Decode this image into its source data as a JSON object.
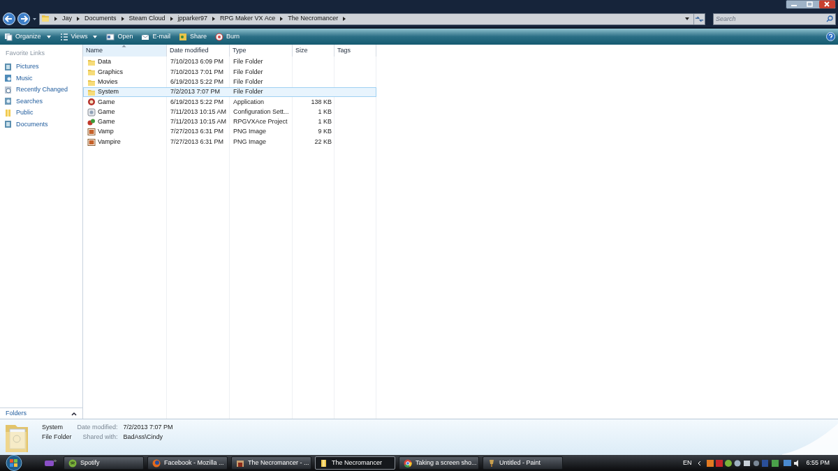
{
  "address_bar": {
    "crumbs": [
      "Jay",
      "Documents",
      "Steam Cloud",
      "jpparker97",
      "RPG Maker VX Ace",
      "The Necromancer"
    ]
  },
  "search": {
    "placeholder": "Search"
  },
  "toolbar": [
    {
      "label": "Organize",
      "kind": "organize",
      "dropdown": true
    },
    {
      "label": "Views",
      "kind": "views",
      "dropdown": true
    },
    {
      "label": "Open",
      "kind": "open",
      "dropdown": false
    },
    {
      "label": "E-mail",
      "kind": "email",
      "dropdown": false
    },
    {
      "label": "Share",
      "kind": "share",
      "dropdown": false
    },
    {
      "label": "Burn",
      "kind": "burn",
      "dropdown": false
    }
  ],
  "sidebar": {
    "heading": "Favorite Links",
    "items": [
      {
        "label": "Pictures",
        "kind": "library"
      },
      {
        "label": "Music",
        "kind": "music"
      },
      {
        "label": "Recently Changed",
        "kind": "recent"
      },
      {
        "label": "Searches",
        "kind": "searches"
      },
      {
        "label": "Public",
        "kind": "folder"
      },
      {
        "label": "Documents",
        "kind": "library"
      }
    ],
    "folders_label": "Folders"
  },
  "table": {
    "columns": [
      {
        "label": "Name",
        "sorted": true
      },
      {
        "label": "Date modified",
        "sorted": false
      },
      {
        "label": "Type",
        "sorted": false
      },
      {
        "label": "Size",
        "sorted": false
      },
      {
        "label": "Tags",
        "sorted": false
      }
    ],
    "rows": [
      {
        "name": "Data",
        "date": "7/10/2013 6:09 PM",
        "type": "File Folder",
        "size": "",
        "kind": "folder",
        "selected": false
      },
      {
        "name": "Graphics",
        "date": "7/10/2013 7:01 PM",
        "type": "File Folder",
        "size": "",
        "kind": "folder",
        "selected": false
      },
      {
        "name": "Movies",
        "date": "6/19/2013 5:22 PM",
        "type": "File Folder",
        "size": "",
        "kind": "folder",
        "selected": false
      },
      {
        "name": "System",
        "date": "7/2/2013 7:07 PM",
        "type": "File Folder",
        "size": "",
        "kind": "folder",
        "selected": true
      },
      {
        "name": "Game",
        "date": "6/19/2013 5:22 PM",
        "type": "Application",
        "size": "138 KB",
        "kind": "app",
        "selected": false
      },
      {
        "name": "Game",
        "date": "7/11/2013 10:15 AM",
        "type": "Configuration Sett...",
        "size": "1 KB",
        "kind": "config",
        "selected": false
      },
      {
        "name": "Game",
        "date": "7/11/2013 10:15 AM",
        "type": "RPGVXAce Project",
        "size": "1 KB",
        "kind": "project",
        "selected": false
      },
      {
        "name": "Vamp",
        "date": "7/27/2013 6:31 PM",
        "type": "PNG Image",
        "size": "9 KB",
        "kind": "image",
        "selected": false
      },
      {
        "name": "Vampire",
        "date": "7/27/2013 6:31 PM",
        "type": "PNG Image",
        "size": "22 KB",
        "kind": "image",
        "selected": false
      }
    ]
  },
  "details": {
    "name": "System",
    "type": "File Folder",
    "fields": [
      {
        "label": "Date modified:",
        "value": "7/2/2013 7:07 PM"
      },
      {
        "label": "Shared with:",
        "value": "BadAss\\Cindy"
      }
    ]
  },
  "taskbar": {
    "items": [
      {
        "label": "Spotify",
        "kind": "spotify",
        "selected": false
      },
      {
        "label": "Facebook - Mozilla ...",
        "kind": "firefox",
        "selected": false
      },
      {
        "label": "The Necromancer - ...",
        "kind": "game",
        "selected": false
      },
      {
        "label": "The Necromancer",
        "kind": "folder",
        "selected": true
      },
      {
        "label": "Taking a screen sho...",
        "kind": "chrome",
        "selected": false
      },
      {
        "label": "Untitled - Paint",
        "kind": "paint",
        "selected": false
      }
    ],
    "language": "EN",
    "time": "6:55 PM"
  }
}
